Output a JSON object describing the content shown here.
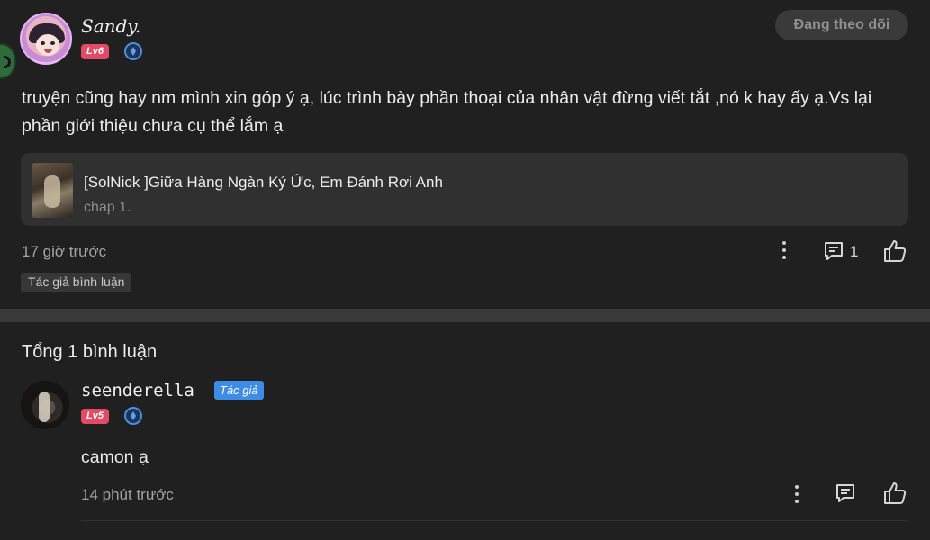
{
  "main_comment": {
    "username": "Sandy.",
    "level": "Lv6",
    "follow_label": "Đang theo dõi",
    "text": "truyện cũng hay nm mình xin góp ý ạ, lúc trình bày phần thoại của nhân vật đừng viết tắt ,nó k hay ấy ạ.Vs lại phần giới thiệu chưa cụ thể lắm ạ",
    "story": {
      "title": "[SolNick ]Giữa Hàng Ngàn Ký Ức, Em Đánh Rơi Anh",
      "chapter": "chap 1."
    },
    "time": "17 giờ trước",
    "reply_count": "1",
    "author_commented_tag": "Tác giả bình luận"
  },
  "replies_section": {
    "total_label": "Tổng 1 bình luận",
    "replies": [
      {
        "username": "seenderella",
        "author_badge": "Tác giả",
        "level": "Lv5",
        "text": "camon ạ",
        "time": "14 phút trước"
      }
    ]
  },
  "colors": {
    "background": "#202020",
    "level_badge": "#e34a66",
    "author_badge": "#3d8de8",
    "card": "#303030"
  },
  "icons": [
    "more-vertical-icon",
    "comment-icon",
    "thumbs-up-icon",
    "verified-icon"
  ]
}
